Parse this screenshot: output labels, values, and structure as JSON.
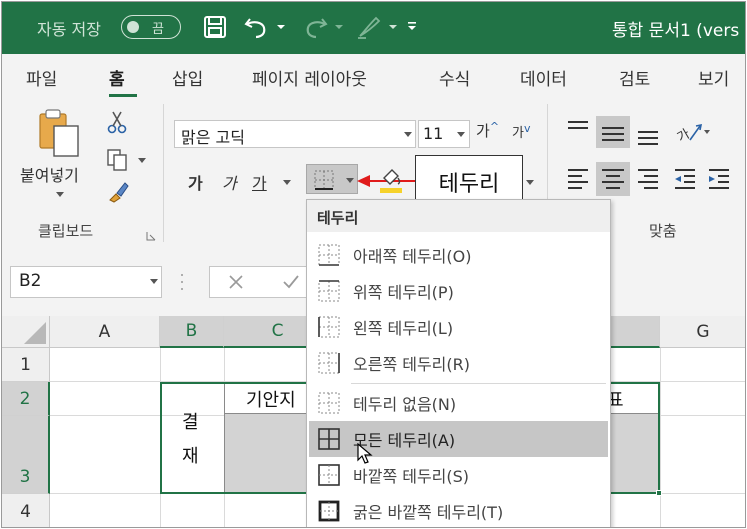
{
  "titlebar": {
    "autosave_label": "자동 저장",
    "autosave_toggle": "끔",
    "doc_title": "통합 문서1 (vers"
  },
  "tabs": [
    "파일",
    "홈",
    "삽입",
    "페이지 레이아웃",
    "수식",
    "데이터",
    "검토",
    "보기"
  ],
  "active_tab": "홈",
  "clipboard": {
    "paste_label": "붙여넣기",
    "group_label": "클립보드"
  },
  "font": {
    "name": "맑은 고딕",
    "size": "11",
    "bold": "가",
    "italic": "가",
    "underline": "가",
    "grow": "가",
    "shrink": "가"
  },
  "alignment": {
    "group_label": "맞춤"
  },
  "callout_text": "테두리",
  "name_box": "B2",
  "columns": [
    "A",
    "B",
    "C",
    "G"
  ],
  "rows": [
    "1",
    "2",
    "3",
    "4"
  ],
  "cells": {
    "b2": "결",
    "b2_line2": "재",
    "c2": "기안지",
    "f2": "표"
  },
  "border_menu": {
    "title": "테두리",
    "items": [
      {
        "label": "아래쪽 테두리(O)",
        "icon": "bottom-border-icon"
      },
      {
        "label": "위쪽 테두리(P)",
        "icon": "top-border-icon"
      },
      {
        "label": "왼쪽 테두리(L)",
        "icon": "left-border-icon"
      },
      {
        "label": "오른쪽 테두리(R)",
        "icon": "right-border-icon"
      },
      {
        "label": "테두리 없음(N)",
        "icon": "no-border-icon"
      },
      {
        "label": "모든 테두리(A)",
        "icon": "all-borders-icon"
      },
      {
        "label": "바깥쪽 테두리(S)",
        "icon": "outside-borders-icon"
      },
      {
        "label": "굵은 바깥쪽 테두리(T)",
        "icon": "thick-outside-borders-icon"
      }
    ],
    "highlighted_index": 5
  },
  "colors": {
    "brand": "#217346",
    "ribbon_bg": "#f3f3f3",
    "arrow": "#e01b1b"
  }
}
